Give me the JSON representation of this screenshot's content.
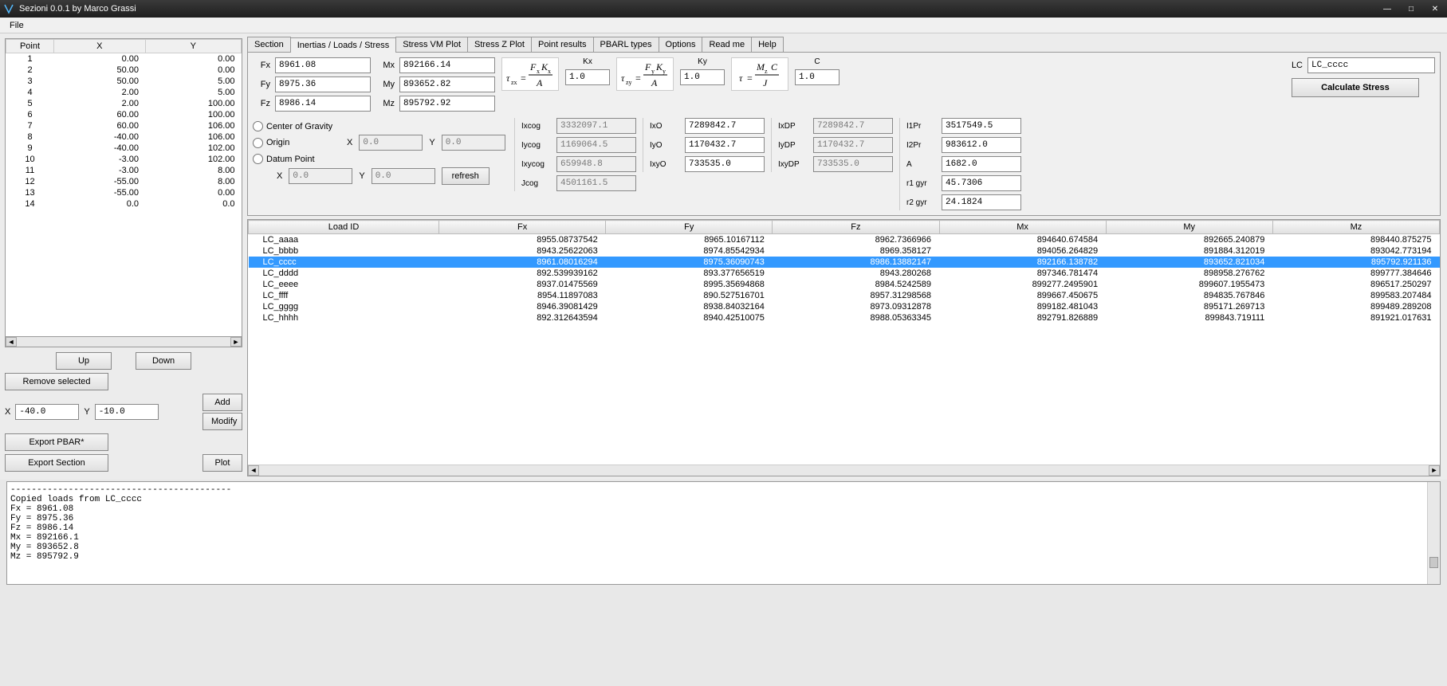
{
  "window": {
    "title": "Sezioni 0.0.1 by Marco Grassi"
  },
  "menu": {
    "file": "File"
  },
  "tabs": {
    "items": [
      "Section",
      "Inertias / Loads / Stress",
      "Stress VM Plot",
      "Stress Z Plot",
      "Point results",
      "PBARL types",
      "Options",
      "Read me",
      "Help"
    ],
    "active": 1
  },
  "points": {
    "headers": [
      "Point",
      "X",
      "Y"
    ],
    "rows": [
      {
        "n": "1",
        "x": "0.00",
        "y": "0.00"
      },
      {
        "n": "2",
        "x": "50.00",
        "y": "0.00"
      },
      {
        "n": "3",
        "x": "50.00",
        "y": "5.00"
      },
      {
        "n": "4",
        "x": "2.00",
        "y": "5.00"
      },
      {
        "n": "5",
        "x": "2.00",
        "y": "100.00"
      },
      {
        "n": "6",
        "x": "60.00",
        "y": "100.00"
      },
      {
        "n": "7",
        "x": "60.00",
        "y": "106.00"
      },
      {
        "n": "8",
        "x": "-40.00",
        "y": "106.00"
      },
      {
        "n": "9",
        "x": "-40.00",
        "y": "102.00"
      },
      {
        "n": "10",
        "x": "-3.00",
        "y": "102.00"
      },
      {
        "n": "11",
        "x": "-3.00",
        "y": "8.00"
      },
      {
        "n": "12",
        "x": "-55.00",
        "y": "8.00"
      },
      {
        "n": "13",
        "x": "-55.00",
        "y": "0.00"
      },
      {
        "n": "14",
        "x": "0.0",
        "y": "0.0"
      }
    ]
  },
  "point_buttons": {
    "up": "Up",
    "down": "Down",
    "remove": "Remove selected",
    "add": "Add",
    "modify": "Modify",
    "export_pbar": "Export PBAR*",
    "export_section": "Export Section",
    "plot": "Plot",
    "x_label": "X",
    "y_label": "Y",
    "x_val": "-40.0",
    "y_val": "-10.0"
  },
  "forces": {
    "Fx": {
      "label": "Fx",
      "val": "8961.08"
    },
    "Fy": {
      "label": "Fy",
      "val": "8975.36"
    },
    "Fz": {
      "label": "Fz",
      "val": "8986.14"
    },
    "Mx": {
      "label": "Mx",
      "val": "892166.14"
    },
    "My": {
      "label": "My",
      "val": "893652.82"
    },
    "Mz": {
      "label": "Mz",
      "val": "895792.92"
    },
    "Kx": {
      "label": "Kx",
      "val": "1.0"
    },
    "Ky": {
      "label": "Ky",
      "val": "1.0"
    },
    "C": {
      "label": "C",
      "val": "1.0"
    },
    "LC": {
      "label": "LC",
      "val": "LC_cccc"
    },
    "calc": "Calculate Stress"
  },
  "origin": {
    "cog": "Center of Gravity",
    "origin": "Origin",
    "datum": "Datum Point",
    "X": "X",
    "Y": "Y",
    "x1": "0.0",
    "y1": "0.0",
    "x2": "0.0",
    "y2": "0.0",
    "refresh": "refresh"
  },
  "inertia": {
    "Ixcog": {
      "l": "Ixcog",
      "v": "3332097.1"
    },
    "Iycog": {
      "l": "Iycog",
      "v": "1169064.5"
    },
    "Ixycog": {
      "l": "Ixycog",
      "v": "659948.8"
    },
    "Jcog": {
      "l": "Jcog",
      "v": "4501161.5"
    },
    "IxO": {
      "l": "IxO",
      "v": "7289842.7"
    },
    "IyO": {
      "l": "IyO",
      "v": "1170432.7"
    },
    "IxyO": {
      "l": "IxyO",
      "v": "733535.0"
    },
    "IxDP": {
      "l": "IxDP",
      "v": "7289842.7"
    },
    "IyDP": {
      "l": "IyDP",
      "v": "1170432.7"
    },
    "IxyDP": {
      "l": "IxyDP",
      "v": "733535.0"
    },
    "I1Pr": {
      "l": "I1Pr",
      "v": "3517549.5"
    },
    "I2Pr": {
      "l": "I2Pr",
      "v": "983612.0"
    },
    "A": {
      "l": "A",
      "v": "1682.0"
    },
    "r1": {
      "l": "r1 gyr",
      "v": "45.7306"
    },
    "r2": {
      "l": "r2 gyr",
      "v": "24.1824"
    }
  },
  "loads": {
    "headers": [
      "Load ID",
      "Fx",
      "Fy",
      "Fz",
      "Mx",
      "My",
      "Mz"
    ],
    "rows": [
      {
        "id": "LC_aaaa",
        "fx": "8955.08737542",
        "fy": "8965.10167112",
        "fz": "8962.7366966",
        "mx": "894640.674584",
        "my": "892665.240879",
        "mz": "898440.875275"
      },
      {
        "id": "LC_bbbb",
        "fx": "8943.25622063",
        "fy": "8974.85542934",
        "fz": "8969.358127",
        "mx": "894056.264829",
        "my": "891884.312019",
        "mz": "893042.773194"
      },
      {
        "id": "LC_cccc",
        "fx": "8961.08016294",
        "fy": "8975.36090743",
        "fz": "8986.13882147",
        "mx": "892166.138782",
        "my": "893652.821034",
        "mz": "895792.921136",
        "sel": true
      },
      {
        "id": "LC_dddd",
        "fx": "892.539939162",
        "fy": "893.377656519",
        "fz": "8943.280268",
        "mx": "897346.781474",
        "my": "898958.276762",
        "mz": "899777.384646"
      },
      {
        "id": "LC_eeee",
        "fx": "8937.01475569",
        "fy": "8995.35694868",
        "fz": "8984.5242589",
        "mx": "899277.2495901",
        "my": "899607.1955473",
        "mz": "896517.250297"
      },
      {
        "id": "LC_ffff",
        "fx": "8954.11897083",
        "fy": "890.527516701",
        "fz": "8957.31298568",
        "mx": "899667.450675",
        "my": "894835.767846",
        "mz": "899583.207484"
      },
      {
        "id": "LC_gggg",
        "fx": "8946.39081429",
        "fy": "8938.84032164",
        "fz": "8973.09312878",
        "mx": "899182.481043",
        "my": "895171.269713",
        "mz": "899489.289208"
      },
      {
        "id": "LC_hhhh",
        "fx": "892.312643594",
        "fy": "8940.42510075",
        "fz": "8988.05363345",
        "mx": "892791.826889",
        "my": "899843.719111",
        "mz": "891921.017631"
      }
    ]
  },
  "console": {
    "lines": [
      "------------------------------------------",
      "Copied loads from LC_cccc",
      "Fx = 8961.08",
      "Fy = 8975.36",
      "Fz = 8986.14",
      "Mx = 892166.1",
      "My = 893652.8",
      "Mz = 895792.9"
    ]
  }
}
